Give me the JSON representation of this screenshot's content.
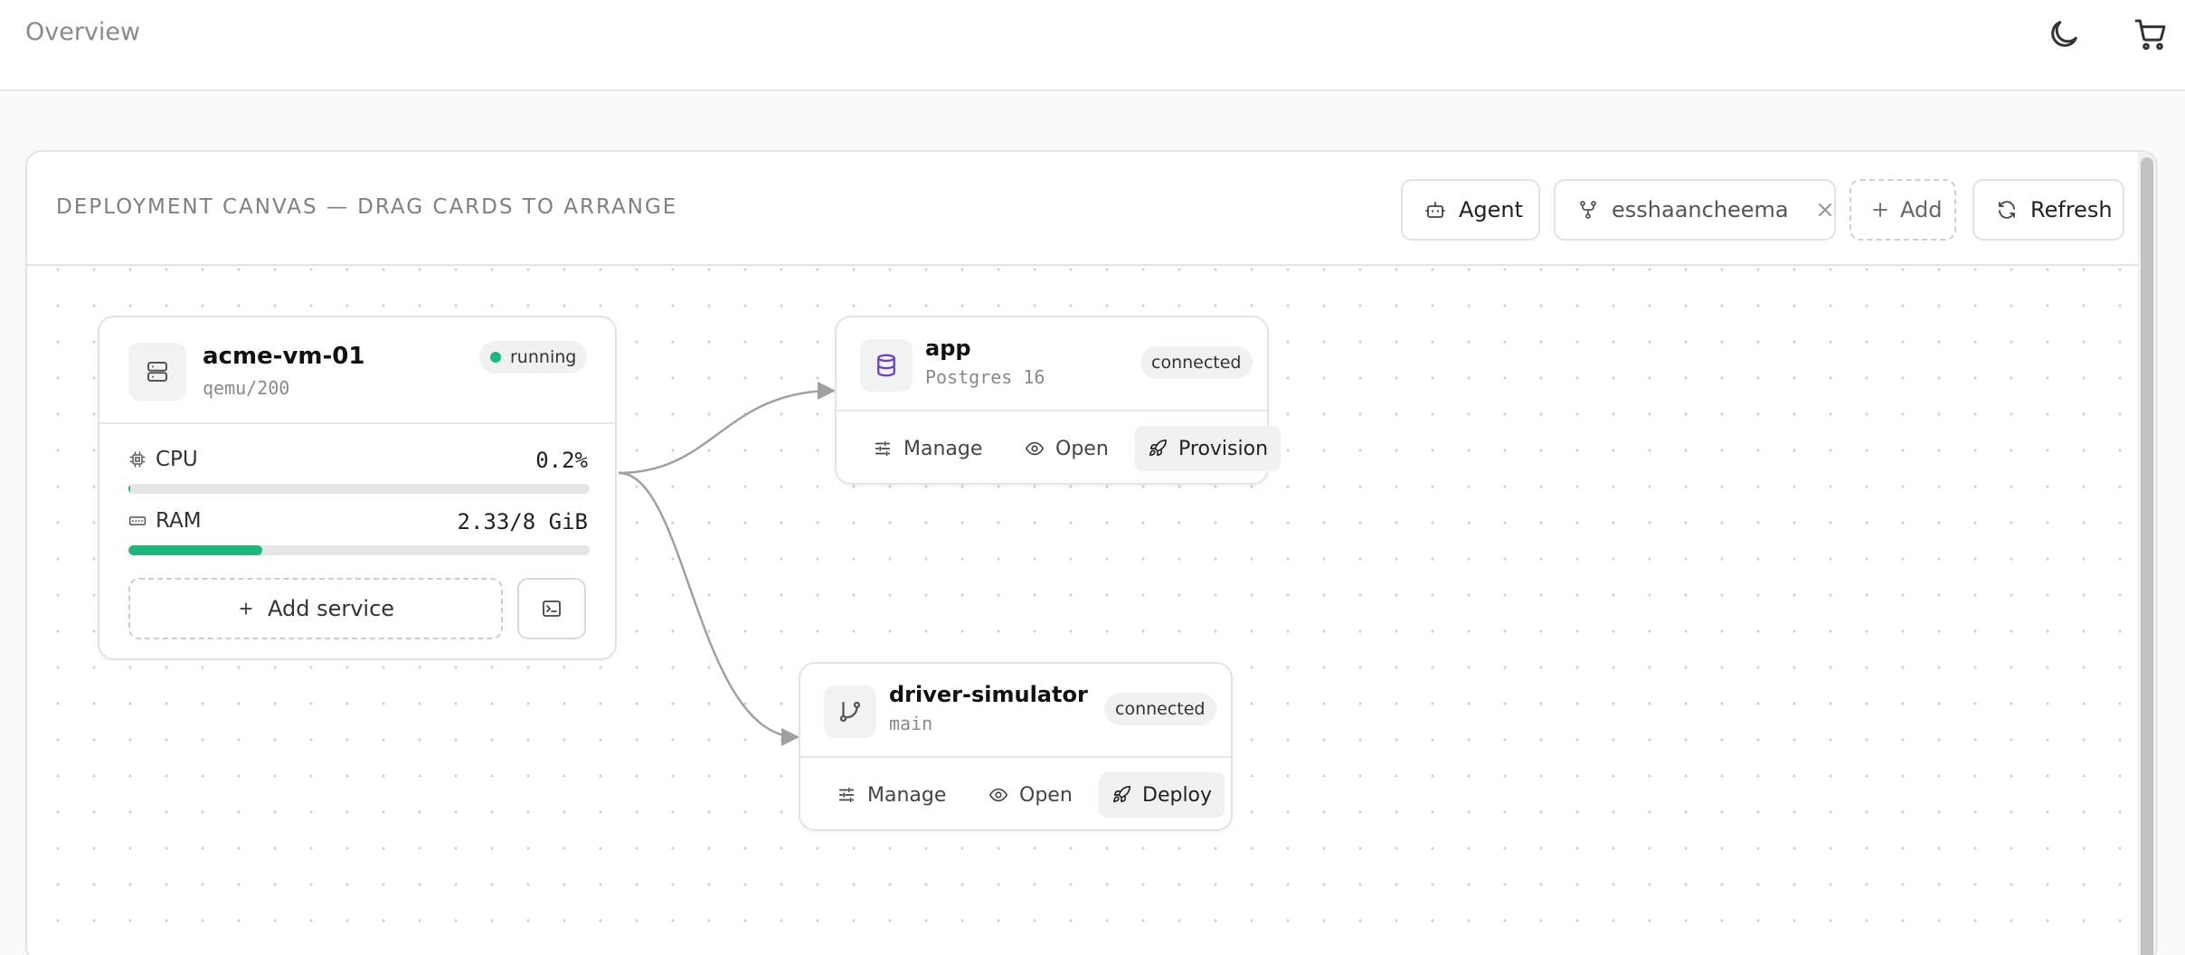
{
  "header": {
    "title": "Overview",
    "icons": [
      "moon-icon",
      "cart-icon"
    ]
  },
  "canvas": {
    "title": "DEPLOYMENT CANVAS — DRAG CARDS TO ARRANGE",
    "buttons": {
      "agent": "Agent",
      "repo_chip": "esshaancheema",
      "add": "Add",
      "refresh": "Refresh"
    }
  },
  "vm_card": {
    "name": "acme-vm-01",
    "subtitle": "qemu/200",
    "status": "running",
    "status_color": "#1ab87a",
    "cpu_label": "CPU",
    "cpu_value": "0.2%",
    "cpu_fraction": 0.002,
    "ram_label": "RAM",
    "ram_value": "2.33/8 GiB",
    "ram_fraction": 0.29,
    "add_service": "Add service"
  },
  "db_card": {
    "name": "app",
    "subtitle": "Postgres 16",
    "status": "connected",
    "actions": {
      "manage": "Manage",
      "open": "Open",
      "primary": "Provision"
    }
  },
  "repo_card": {
    "name": "driver-simulator",
    "subtitle": "main",
    "status": "connected",
    "actions": {
      "manage": "Manage",
      "open": "Open",
      "primary": "Deploy"
    }
  },
  "colors": {
    "accent_green": "#1ab87a",
    "db_icon": "#6a3fc7",
    "edge": "#a0a0a0"
  }
}
